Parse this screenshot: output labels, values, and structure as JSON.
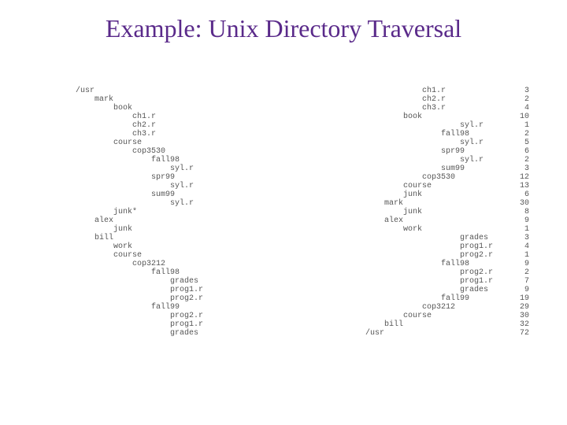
{
  "title": "Example: Unix Directory Traversal",
  "left_col": [
    "/usr",
    "    mark",
    "        book",
    "            ch1.r",
    "            ch2.r",
    "            ch3.r",
    "        course",
    "            cop3530",
    "                fall98",
    "                    syl.r",
    "                spr99",
    "                    syl.r",
    "                sum99",
    "                    syl.r",
    "        junk*",
    "    alex",
    "        junk",
    "    bill",
    "        work",
    "        course",
    "            cop3212",
    "                fall98",
    "                    grades",
    "                    prog1.r",
    "                    prog2.r",
    "                fall99",
    "                    prog2.r",
    "                    prog1.r",
    "                    grades"
  ],
  "right_col": [
    {
      "name": "                    ch1.r",
      "val": "3"
    },
    {
      "name": "                    ch2.r",
      "val": "2"
    },
    {
      "name": "                    ch3.r",
      "val": "4"
    },
    {
      "name": "                book",
      "val": "10"
    },
    {
      "name": "                            syl.r",
      "val": "1"
    },
    {
      "name": "                        fall98",
      "val": "2"
    },
    {
      "name": "                            syl.r",
      "val": "5"
    },
    {
      "name": "                        spr99",
      "val": "6"
    },
    {
      "name": "                            syl.r",
      "val": "2"
    },
    {
      "name": "                        sum99",
      "val": "3"
    },
    {
      "name": "                    cop3530",
      "val": "12"
    },
    {
      "name": "                course",
      "val": "13"
    },
    {
      "name": "                junk",
      "val": "6"
    },
    {
      "name": "            mark",
      "val": "30"
    },
    {
      "name": "                junk",
      "val": "8"
    },
    {
      "name": "            alex",
      "val": "9"
    },
    {
      "name": "                work",
      "val": "1"
    },
    {
      "name": "                            grades",
      "val": "3"
    },
    {
      "name": "                            prog1.r",
      "val": "4"
    },
    {
      "name": "                            prog2.r",
      "val": "1"
    },
    {
      "name": "                        fall98",
      "val": "9"
    },
    {
      "name": "                            prog2.r",
      "val": "2"
    },
    {
      "name": "                            prog1.r",
      "val": "7"
    },
    {
      "name": "                            grades",
      "val": "9"
    },
    {
      "name": "                        fall99",
      "val": "19"
    },
    {
      "name": "                    cop3212",
      "val": "29"
    },
    {
      "name": "                course",
      "val": "30"
    },
    {
      "name": "            bill",
      "val": "32"
    },
    {
      "name": "        /usr",
      "val": "72"
    }
  ]
}
